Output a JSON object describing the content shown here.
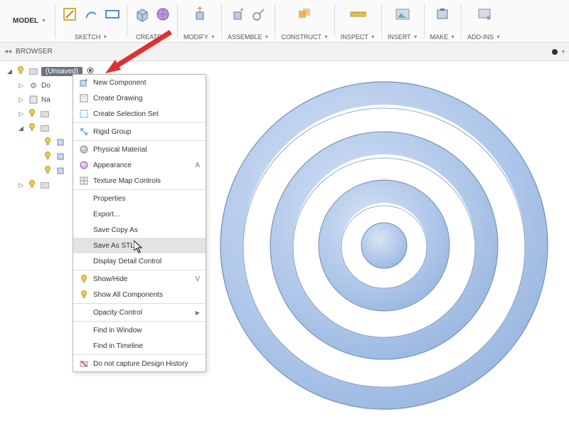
{
  "toolbar": {
    "model_label": "MODEL",
    "groups": [
      {
        "name": "sketch",
        "label": "SKETCH"
      },
      {
        "name": "create",
        "label": "CREATE"
      },
      {
        "name": "modify",
        "label": "MODIFY"
      },
      {
        "name": "assemble",
        "label": "ASSEMBLE"
      },
      {
        "name": "construct",
        "label": "CONSTRUCT"
      },
      {
        "name": "inspect",
        "label": "INSPECT"
      },
      {
        "name": "insert",
        "label": "INSERT"
      },
      {
        "name": "make",
        "label": "MAKE"
      },
      {
        "name": "addins",
        "label": "ADD-INS"
      }
    ]
  },
  "browser": {
    "title": "BROWSER",
    "root_label": "(Unsaved)",
    "rows": [
      {
        "label": "Do"
      },
      {
        "label": "Na"
      }
    ]
  },
  "context_menu": {
    "items": [
      {
        "label": "New Component",
        "icon": "new-component-icon"
      },
      {
        "label": "Create Drawing",
        "icon": "create-drawing-icon"
      },
      {
        "label": "Create Selection Set",
        "icon": "selection-set-icon"
      },
      {
        "sep": true
      },
      {
        "label": "Rigid Group",
        "icon": "rigid-group-icon"
      },
      {
        "sep": true
      },
      {
        "label": "Physical Material",
        "icon": "physical-material-icon"
      },
      {
        "label": "Appearance",
        "icon": "appearance-icon",
        "shortcut": "A"
      },
      {
        "label": "Texture Map Controls",
        "icon": "texture-map-icon"
      },
      {
        "sep": true
      },
      {
        "label": "Properties"
      },
      {
        "label": "Export..."
      },
      {
        "label": "Save Copy As"
      },
      {
        "label": "Save As STL",
        "highlight": true
      },
      {
        "label": "Display Detail Control"
      },
      {
        "sep": true
      },
      {
        "label": "Show/Hide",
        "icon": "bulb-icon",
        "shortcut": "V"
      },
      {
        "label": "Show All Components",
        "icon": "bulb-icon"
      },
      {
        "sep": true
      },
      {
        "label": "Opacity Control",
        "submenu": true
      },
      {
        "sep": true
      },
      {
        "label": "Find in Window"
      },
      {
        "label": "Find in Timeline"
      },
      {
        "sep": true
      },
      {
        "label": "Do not capture Design History",
        "icon": "history-off-icon"
      }
    ]
  }
}
